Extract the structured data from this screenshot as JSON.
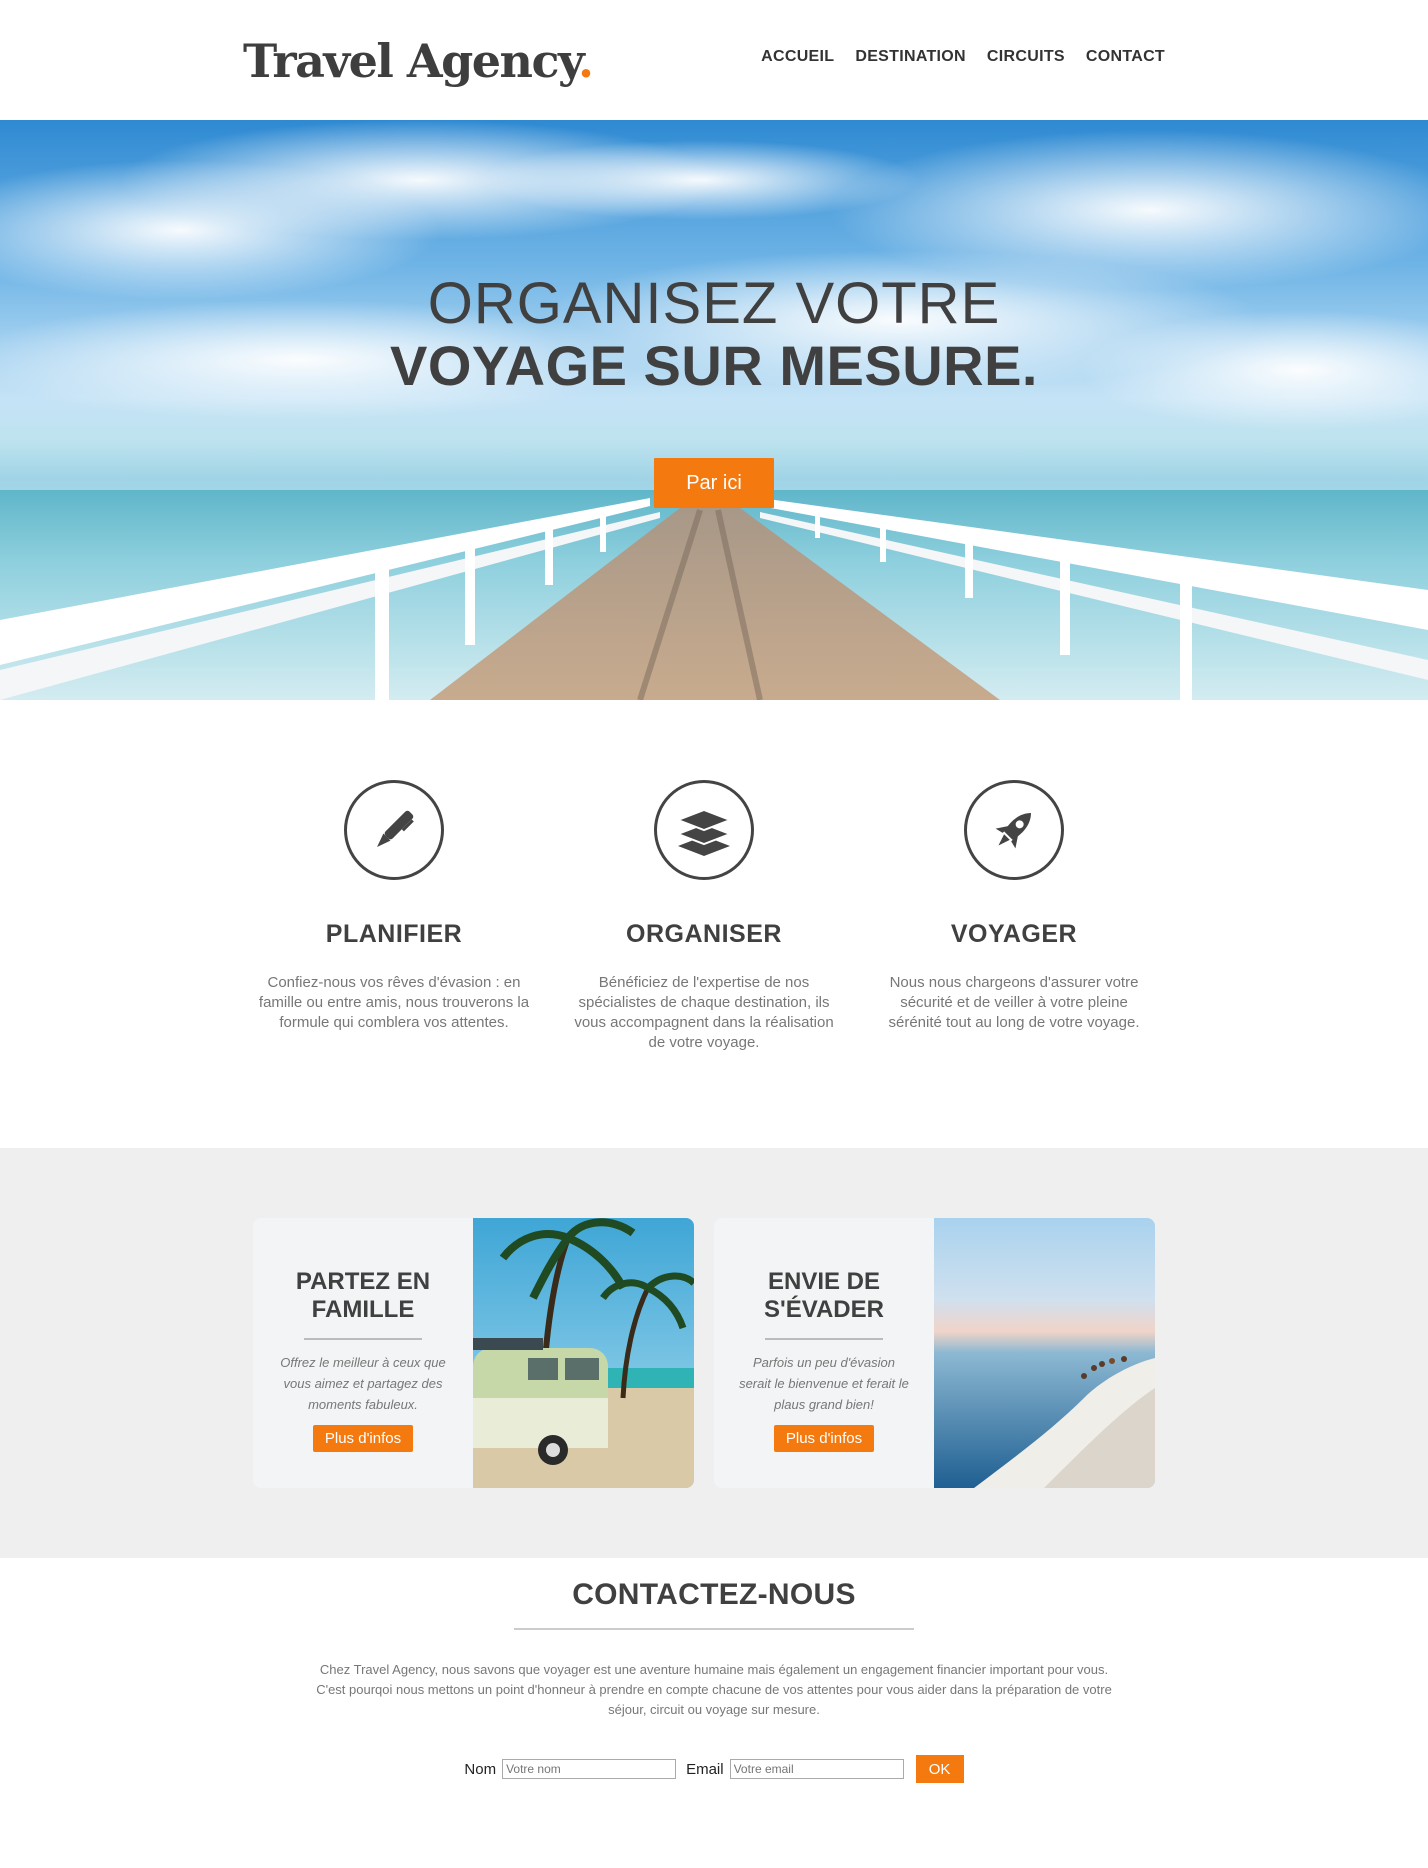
{
  "header": {
    "logo_text": "Travel Agency",
    "logo_dot": ".",
    "nav": [
      "ACCUEIL",
      "DESTINATION",
      "CIRCUITS",
      "CONTACT"
    ]
  },
  "hero": {
    "line1": "ORGANISEZ VOTRE",
    "line2": "VOYAGE SUR MESURE.",
    "button": "Par ici"
  },
  "features": [
    {
      "icon": "pen-icon",
      "title": "PLANIFIER",
      "text": "Confiez-nous vos rêves d'évasion : en famille ou entre amis, nous trouverons la formule qui comblera vos attentes."
    },
    {
      "icon": "layers-icon",
      "title": "ORGANISER",
      "text": "Bénéficiez de l'expertise de nos spécialistes de chaque destination, ils vous accompagnent dans la réalisation de votre voyage."
    },
    {
      "icon": "rocket-icon",
      "title": "VOYAGER",
      "text": "Nous nous chargeons d'assurer votre sécurité et de veiller à votre pleine sérénité tout au long de votre voyage."
    }
  ],
  "cards": [
    {
      "title_line1": "PARTEZ EN",
      "title_line2": "FAMILLE",
      "text": "Offrez le meilleur à ceux que vous aimez et partagez des moments fabuleux.",
      "button": "Plus d'infos"
    },
    {
      "title_line1": "ENVIE DE",
      "title_line2": "S'ÉVADER",
      "text": "Parfois un peu d'évasion serait le bienvenue et ferait le plaus grand bien!",
      "button": "Plus d'infos"
    }
  ],
  "contact": {
    "title": "CONTACTEZ-NOUS",
    "text": "Chez Travel Agency, nous savons que voyager est une aventure humaine mais également un engagement financier important pour vous. C'est pourqoi nous mettons un point d'honneur à prendre en compte chacune de vos attentes pour vous aider dans la préparation de votre séjour, circuit ou voyage sur mesure.",
    "name_label": "Nom",
    "name_placeholder": "Votre nom",
    "email_label": "Email",
    "email_placeholder": "Votre email",
    "submit": "OK"
  },
  "colors": {
    "accent": "#f47a0f",
    "text_dark": "#404040",
    "text_muted": "#777777",
    "section_gray": "#efefef"
  }
}
